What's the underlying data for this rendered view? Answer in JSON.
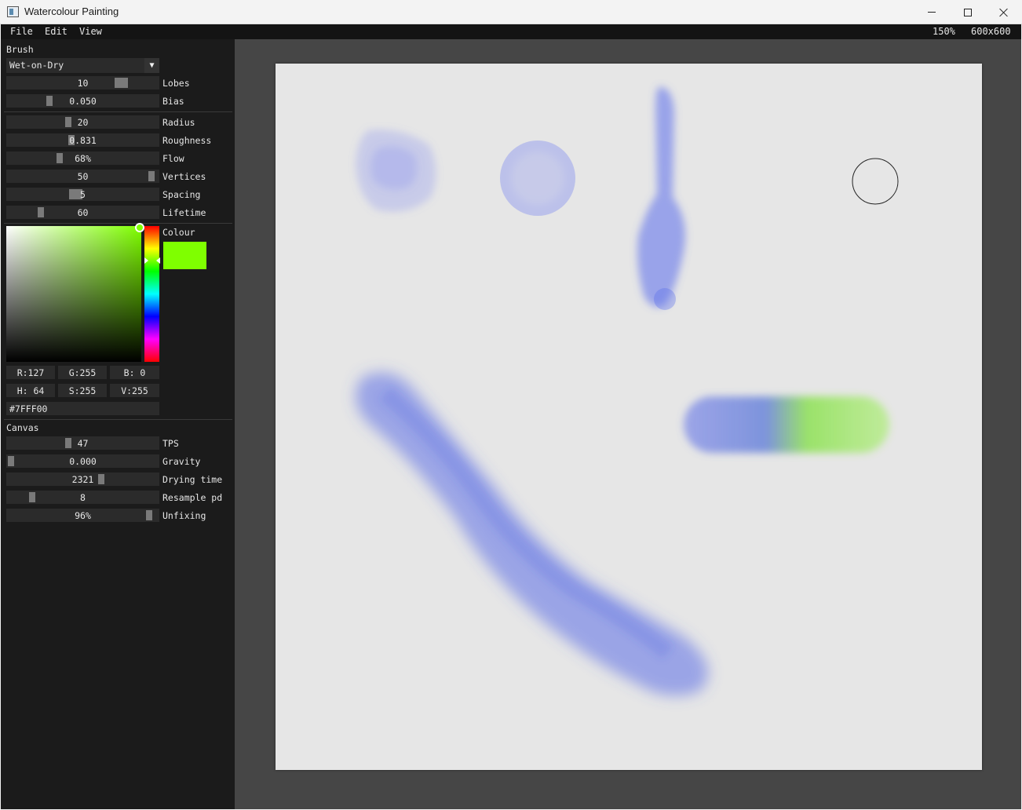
{
  "window": {
    "title": "Watercolour Painting"
  },
  "menu": {
    "file": "File",
    "edit": "Edit",
    "view": "View",
    "zoom": "150%",
    "canvas_size": "600x600"
  },
  "brush": {
    "title": "Brush",
    "mode": "Wet-on-Dry",
    "lobes": {
      "label": "Lobes",
      "value": "10",
      "fraction": 0.78
    },
    "bias": {
      "label": "Bias",
      "value": "0.050",
      "fraction": 0.27
    },
    "radius": {
      "label": "Radius",
      "value": "20",
      "fraction": 0.4
    },
    "roughness": {
      "label": "Roughness",
      "value": "0.831",
      "fraction": 0.42
    },
    "flow": {
      "label": "Flow",
      "value": "68%",
      "fraction": 0.34
    },
    "vertices": {
      "label": "Vertices",
      "value": "50",
      "fraction": 0.98
    },
    "spacing": {
      "label": "Spacing",
      "value": "5",
      "fraction": 0.45
    },
    "lifetime": {
      "label": "Lifetime",
      "value": "60",
      "fraction": 0.21
    }
  },
  "colour": {
    "label": "Colour",
    "value_hex": "#7fff00",
    "r": "R:127",
    "g": "G:255",
    "b": "B:  0",
    "h": "H: 64",
    "s": "S:255",
    "v": "V:255",
    "hex": "#7FFF00"
  },
  "canvas": {
    "title": "Canvas",
    "tps": {
      "label": "TPS",
      "value": "47",
      "fraction": 0.4
    },
    "gravity": {
      "label": "Gravity",
      "value": "0.000",
      "fraction": 0.0
    },
    "drying_time": {
      "label": "Drying time",
      "value": "2321",
      "fraction": 0.63
    },
    "resample": {
      "label": "Resample pd",
      "value": "8",
      "fraction": 0.15
    },
    "unfixing": {
      "label": "Unfixing",
      "value": "96%",
      "fraction": 0.96
    },
    "background": "#e6e6e6",
    "paint_blue": "#5f6ee8",
    "paint_green": "#8cf03c"
  }
}
